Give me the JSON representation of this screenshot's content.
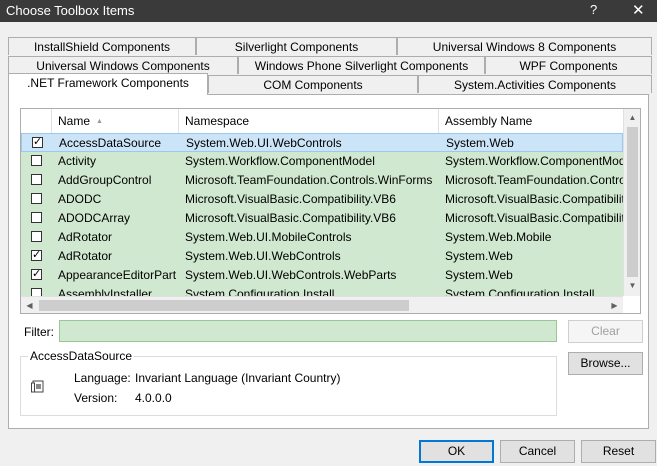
{
  "window": {
    "title": "Choose Toolbox Items",
    "help": "?",
    "close": "✕"
  },
  "tabs": {
    "row1": [
      {
        "label": "InstallShield Components"
      },
      {
        "label": "Silverlight Components"
      },
      {
        "label": "Universal Windows 8 Components"
      }
    ],
    "row2": [
      {
        "label": "Universal Windows Components"
      },
      {
        "label": "Windows Phone Silverlight Components"
      },
      {
        "label": "WPF Components"
      }
    ],
    "row3": [
      {
        "label": ".NET Framework Components",
        "active": true
      },
      {
        "label": "COM Components"
      },
      {
        "label": "System.Activities Components"
      }
    ]
  },
  "list": {
    "columns": [
      "Name",
      "Namespace",
      "Assembly Name"
    ],
    "rows": [
      {
        "checked": true,
        "name": "AccessDataSource",
        "namespace": "System.Web.UI.WebControls",
        "assembly": "System.Web",
        "selected": true
      },
      {
        "checked": false,
        "name": "Activity",
        "namespace": "System.Workflow.ComponentModel",
        "assembly": "System.Workflow.ComponentMod"
      },
      {
        "checked": false,
        "name": "AddGroupControl",
        "namespace": "Microsoft.TeamFoundation.Controls.WinForms",
        "assembly": "Microsoft.TeamFoundation.Contro"
      },
      {
        "checked": false,
        "name": "ADODC",
        "namespace": "Microsoft.VisualBasic.Compatibility.VB6",
        "assembly": "Microsoft.VisualBasic.Compatibilit"
      },
      {
        "checked": false,
        "name": "ADODCArray",
        "namespace": "Microsoft.VisualBasic.Compatibility.VB6",
        "assembly": "Microsoft.VisualBasic.Compatibilit"
      },
      {
        "checked": false,
        "name": "AdRotator",
        "namespace": "System.Web.UI.MobileControls",
        "assembly": "System.Web.Mobile"
      },
      {
        "checked": true,
        "name": "AdRotator",
        "namespace": "System.Web.UI.WebControls",
        "assembly": "System.Web"
      },
      {
        "checked": true,
        "name": "AppearanceEditorPart",
        "namespace": "System.Web.UI.WebControls.WebParts",
        "assembly": "System.Web"
      },
      {
        "checked": false,
        "name": "AssemblyInstaller",
        "namespace": "System.Configuration.Install",
        "assembly": "System.Configuration.Install"
      }
    ]
  },
  "filter": {
    "label": "Filter:",
    "value": "",
    "clear_label": "Clear"
  },
  "details": {
    "title": "AccessDataSource",
    "language_label": "Language:",
    "language_value": "Invariant Language (Invariant Country)",
    "version_label": "Version:",
    "version_value": "4.0.0.0",
    "browse_label": "Browse..."
  },
  "footer": {
    "ok_label": "OK",
    "cancel_label": "Cancel",
    "reset_label": "Reset"
  }
}
